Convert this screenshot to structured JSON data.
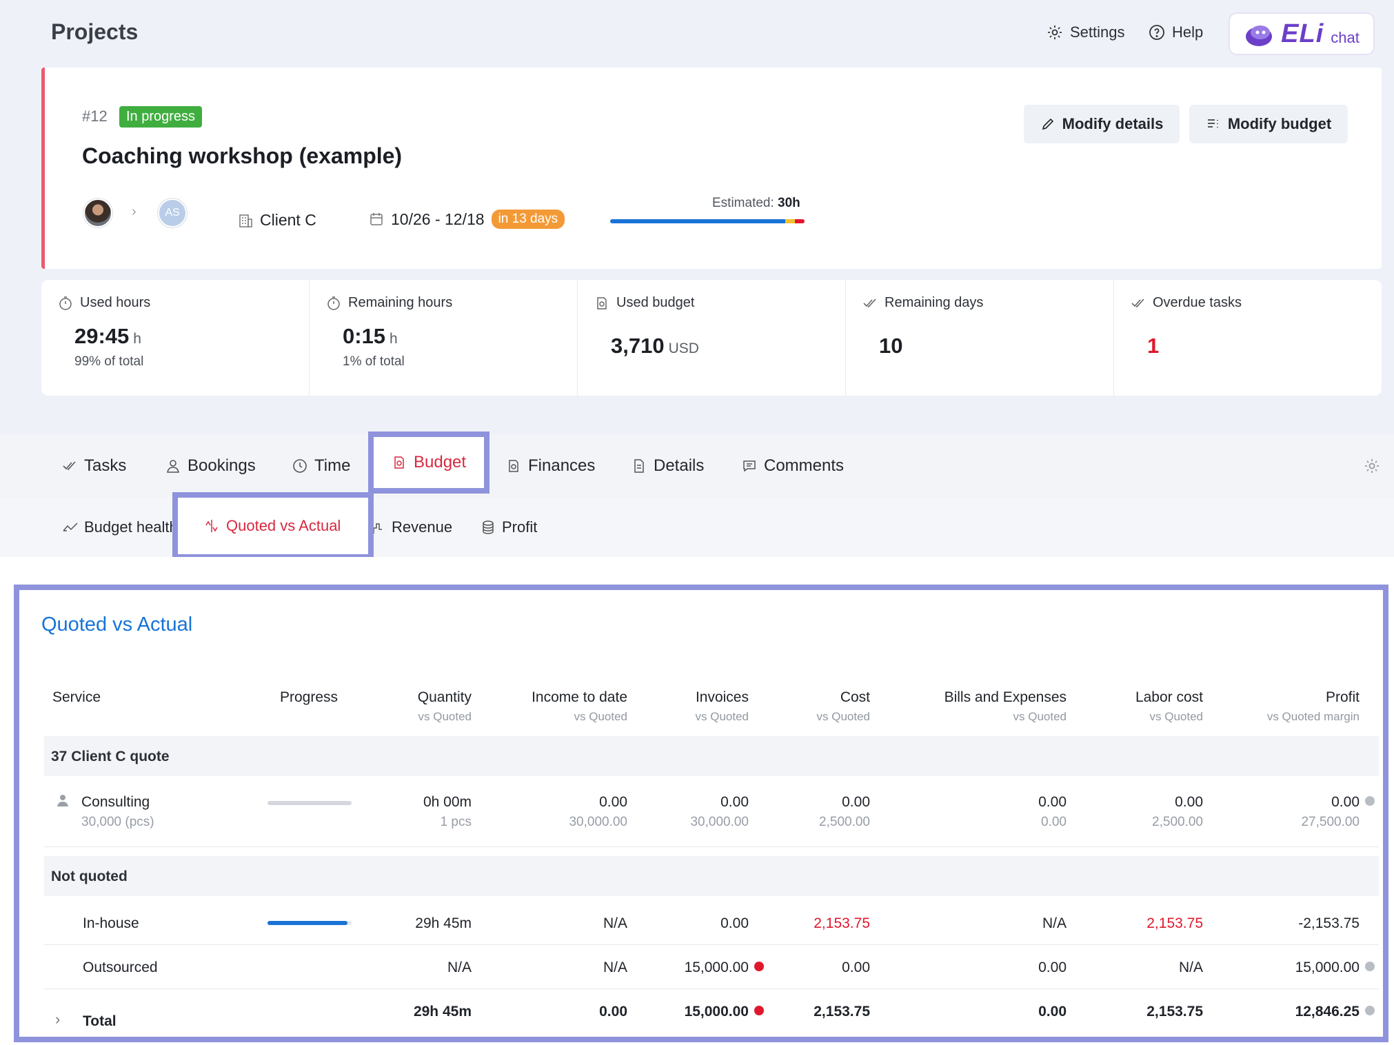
{
  "header": {
    "title": "Projects",
    "settings_label": "Settings",
    "help_label": "Help",
    "eli_logo": "ELi",
    "eli_chat_label": "chat"
  },
  "project": {
    "number": "#12",
    "status": "In progress",
    "name": "Coaching workshop (example)",
    "assignee_initials": "AS",
    "client": "Client C",
    "dates": "10/26 - 12/18",
    "due": "in 13 days",
    "estimate_label": "Estimated:",
    "estimate_value": "30h",
    "estimate_bar_fractions": {
      "used": 0.9,
      "warning": 0.05,
      "over": 0.05
    },
    "modify_details_label": "Modify details",
    "modify_budget_label": "Modify budget"
  },
  "stats": {
    "used_hours": {
      "label": "Used hours",
      "value": "29:45",
      "unit": "h",
      "sub": "99% of total"
    },
    "remaining_hours": {
      "label": "Remaining hours",
      "value": "0:15",
      "unit": "h",
      "sub": "1% of total"
    },
    "used_budget": {
      "label": "Used budget",
      "value": "3,710",
      "unit": "USD"
    },
    "remaining_days": {
      "label": "Remaining days",
      "value": "10"
    },
    "overdue_tasks": {
      "label": "Overdue tasks",
      "value": "1"
    }
  },
  "tabs": [
    "Tasks",
    "Bookings",
    "Time",
    "Budget",
    "Finances",
    "Details",
    "Comments"
  ],
  "active_tab": "Budget",
  "subtabs": [
    "Budget health",
    "Quoted vs Actual",
    "Revenue",
    "Profit"
  ],
  "active_subtab": "Quoted vs Actual",
  "panel": {
    "title": "Quoted vs Actual",
    "columns": [
      {
        "label": "Service",
        "sub": ""
      },
      {
        "label": "Progress",
        "sub": ""
      },
      {
        "label": "Quantity",
        "sub": "vs Quoted"
      },
      {
        "label": "Income to date",
        "sub": "vs Quoted"
      },
      {
        "label": "Invoices",
        "sub": "vs Quoted"
      },
      {
        "label": "Cost",
        "sub": "vs Quoted"
      },
      {
        "label": "Bills and Expenses",
        "sub": "vs Quoted"
      },
      {
        "label": "Labor cost",
        "sub": "vs Quoted"
      },
      {
        "label": "Profit",
        "sub": "vs Quoted margin"
      }
    ],
    "groups": {
      "quote": {
        "title": "37 Client C quote"
      },
      "not_quoted": {
        "title": "Not quoted"
      }
    },
    "rows": {
      "consulting": {
        "name": "Consulting",
        "sub": "30,000 (pcs)",
        "progress": 0.0,
        "quantity": "0h 00m",
        "quantity_sub": "1 pcs",
        "income": "0.00",
        "income_sub": "30,000.00",
        "invoices": "0.00",
        "invoices_sub": "30,000.00",
        "cost": "0.00",
        "cost_sub": "2,500.00",
        "bills": "0.00",
        "bills_sub": "0.00",
        "labor": "0.00",
        "labor_sub": "2,500.00",
        "profit": "0.00",
        "profit_sub": "27,500.00"
      },
      "inhouse": {
        "name": "In-house",
        "progress": 0.95,
        "quantity": "29h 45m",
        "income": "N/A",
        "invoices": "0.00",
        "cost": "2,153.75",
        "bills": "N/A",
        "labor": "2,153.75",
        "profit": "-2,153.75"
      },
      "outsourced": {
        "name": "Outsourced",
        "quantity": "N/A",
        "income": "N/A",
        "invoices": "15,000.00",
        "cost": "0.00",
        "bills": "0.00",
        "labor": "N/A",
        "profit": "15,000.00"
      },
      "total": {
        "name": "Total",
        "quantity": "29h 45m",
        "income": "0.00",
        "invoices": "15,000.00",
        "cost": "2,153.75",
        "bills": "0.00",
        "labor": "2,153.75",
        "profit": "12,846.25"
      }
    }
  },
  "colors": {
    "accent_blue": "#1773d6",
    "status_green": "#3fae3f",
    "due_orange": "#f39a36",
    "danger_red": "#e0182d",
    "highlight": "#8e93dc"
  }
}
